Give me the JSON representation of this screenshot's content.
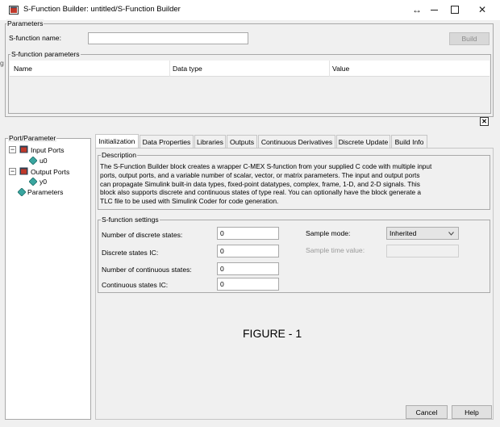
{
  "window": {
    "title": "S-Function Builder: untitled/S-Function Builder",
    "restore_glyph": "↔",
    "minimize_glyph": "—",
    "maximize_glyph": "☐",
    "close_glyph": "✕"
  },
  "parameters": {
    "legend": "Parameters",
    "sfunction_name_label": "S-function name:",
    "sfunction_name_value": "",
    "build_label": "Build"
  },
  "sfunction_parameters": {
    "legend": "S-function parameters",
    "columns": [
      "Name",
      "Data type",
      "Value"
    ],
    "close_glyph": "✕"
  },
  "side_letter": "g",
  "port_parameter": {
    "legend": "Port/Parameter",
    "collapse_glyph": "−",
    "input_ports": "Input Ports",
    "input_child": "u0",
    "output_ports": "Output Ports",
    "output_child": "y0",
    "parameters": "Parameters"
  },
  "tabs": [
    "Initialization",
    "Data Properties",
    "Libraries",
    "Outputs",
    "Continuous Derivatives",
    "Discrete Update",
    "Build Info"
  ],
  "description": {
    "legend": "Description",
    "lines": [
      "The S-Function Builder block creates a wrapper C-MEX S-function from your supplied C code with multiple input",
      "ports, output ports, and a variable number of scalar, vector, or matrix parameters. The input and output ports",
      "can propagate Simulink built-in data types, fixed-point datatypes, complex, frame, 1-D, and 2-D signals. This",
      "block also supports discrete and continuous states of type real. You can optionally have the block generate a",
      "TLC file to be used with Simulink Coder for code generation."
    ]
  },
  "settings": {
    "legend": "S-function settings",
    "num_discrete_label": "Number of discrete states:",
    "num_discrete_value": "0",
    "discrete_ic_label": "Discrete states IC:",
    "discrete_ic_value": "0",
    "num_continuous_label": "Number of continuous states:",
    "num_continuous_value": "0",
    "continuous_ic_label": "Continuous states IC:",
    "continuous_ic_value": "0",
    "sample_mode_label": "Sample mode:",
    "sample_mode_value": "Inherited",
    "sample_time_label": "Sample time value:",
    "sample_time_value": ""
  },
  "figure_caption": "FIGURE - 1",
  "footer": {
    "cancel_label": "Cancel",
    "help_label": "Help"
  }
}
